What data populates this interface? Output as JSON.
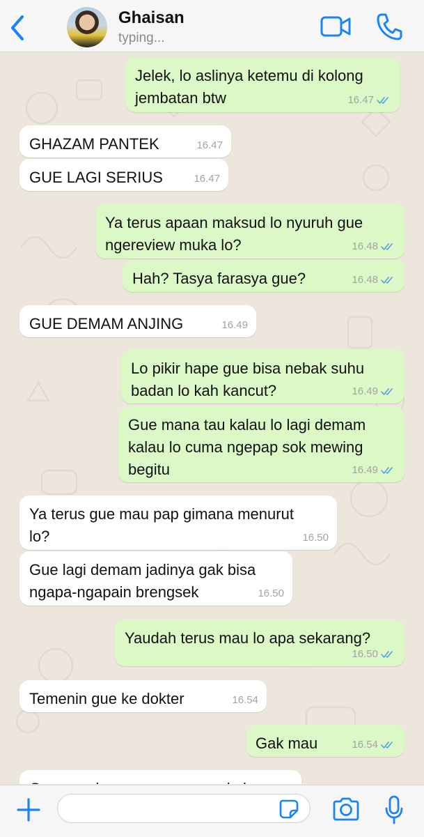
{
  "header": {
    "contact_name": "Ghaisan",
    "status": "typing..."
  },
  "colors": {
    "accent": "#1a84f4",
    "outgoing_bubble": "#dcf8c6",
    "incoming_bubble": "#ffffff",
    "wallpaper": "#ece6dd",
    "read_ticks": "#4fa3e0"
  },
  "icons": [
    "chevron-left-icon",
    "video-camera-icon",
    "phone-icon",
    "plus-icon",
    "sticker-icon",
    "camera-icon",
    "microphone-icon",
    "double-check-icon"
  ],
  "messages": [
    {
      "direction": "out",
      "lines": [
        "Jelek, lo aslinya ketemu di kolong",
        "jembatan btw"
      ],
      "time": "16.47",
      "read": true
    },
    {
      "direction": "in",
      "lines": [
        "GHAZAM PANTEK"
      ],
      "time": "16.47"
    },
    {
      "direction": "in",
      "lines": [
        "GUE LAGI SERIUS"
      ],
      "time": "16.47"
    },
    {
      "direction": "out",
      "lines": [
        "Ya terus apaan maksud lo nyuruh gue",
        "ngereview muka lo?"
      ],
      "time": "16.48",
      "read": true
    },
    {
      "direction": "out",
      "lines": [
        "Hah? Tasya farasya gue?"
      ],
      "time": "16.48",
      "read": true
    },
    {
      "direction": "in",
      "lines": [
        "GUE DEMAM ANJING"
      ],
      "time": "16.49"
    },
    {
      "direction": "out",
      "lines": [
        "Lo pikir hape gue bisa nebak suhu",
        "badan lo kah kancut?"
      ],
      "time": "16.49",
      "read": true
    },
    {
      "direction": "out",
      "lines": [
        "Gue mana tau kalau lo lagi demam",
        "kalau lo cuma ngepap sok mewing",
        "begitu"
      ],
      "time": "16.49",
      "read": true
    },
    {
      "direction": "in",
      "lines": [
        "Ya terus gue mau pap gimana menurut",
        "lo?"
      ],
      "time": "16.50"
    },
    {
      "direction": "in",
      "lines": [
        "Gue lagi demam jadinya gak bisa",
        "ngapa-ngapain brengsek"
      ],
      "time": "16.50"
    },
    {
      "direction": "out",
      "lines": [
        "Yaudah terus mau lo apa sekarang?"
      ],
      "time": "16.50",
      "read": true
    },
    {
      "direction": "in",
      "lines": [
        "Temenin gue ke dokter"
      ],
      "time": "16.54"
    },
    {
      "direction": "out",
      "lines": [
        "Gak mau"
      ],
      "time": "16.54",
      "read": true
    },
    {
      "direction": "in",
      "lines": [
        "Gue sungkan mau ngomong kalau"
      ],
      "time": "",
      "partial": true
    }
  ],
  "composer": {
    "value": "",
    "placeholder": ""
  }
}
